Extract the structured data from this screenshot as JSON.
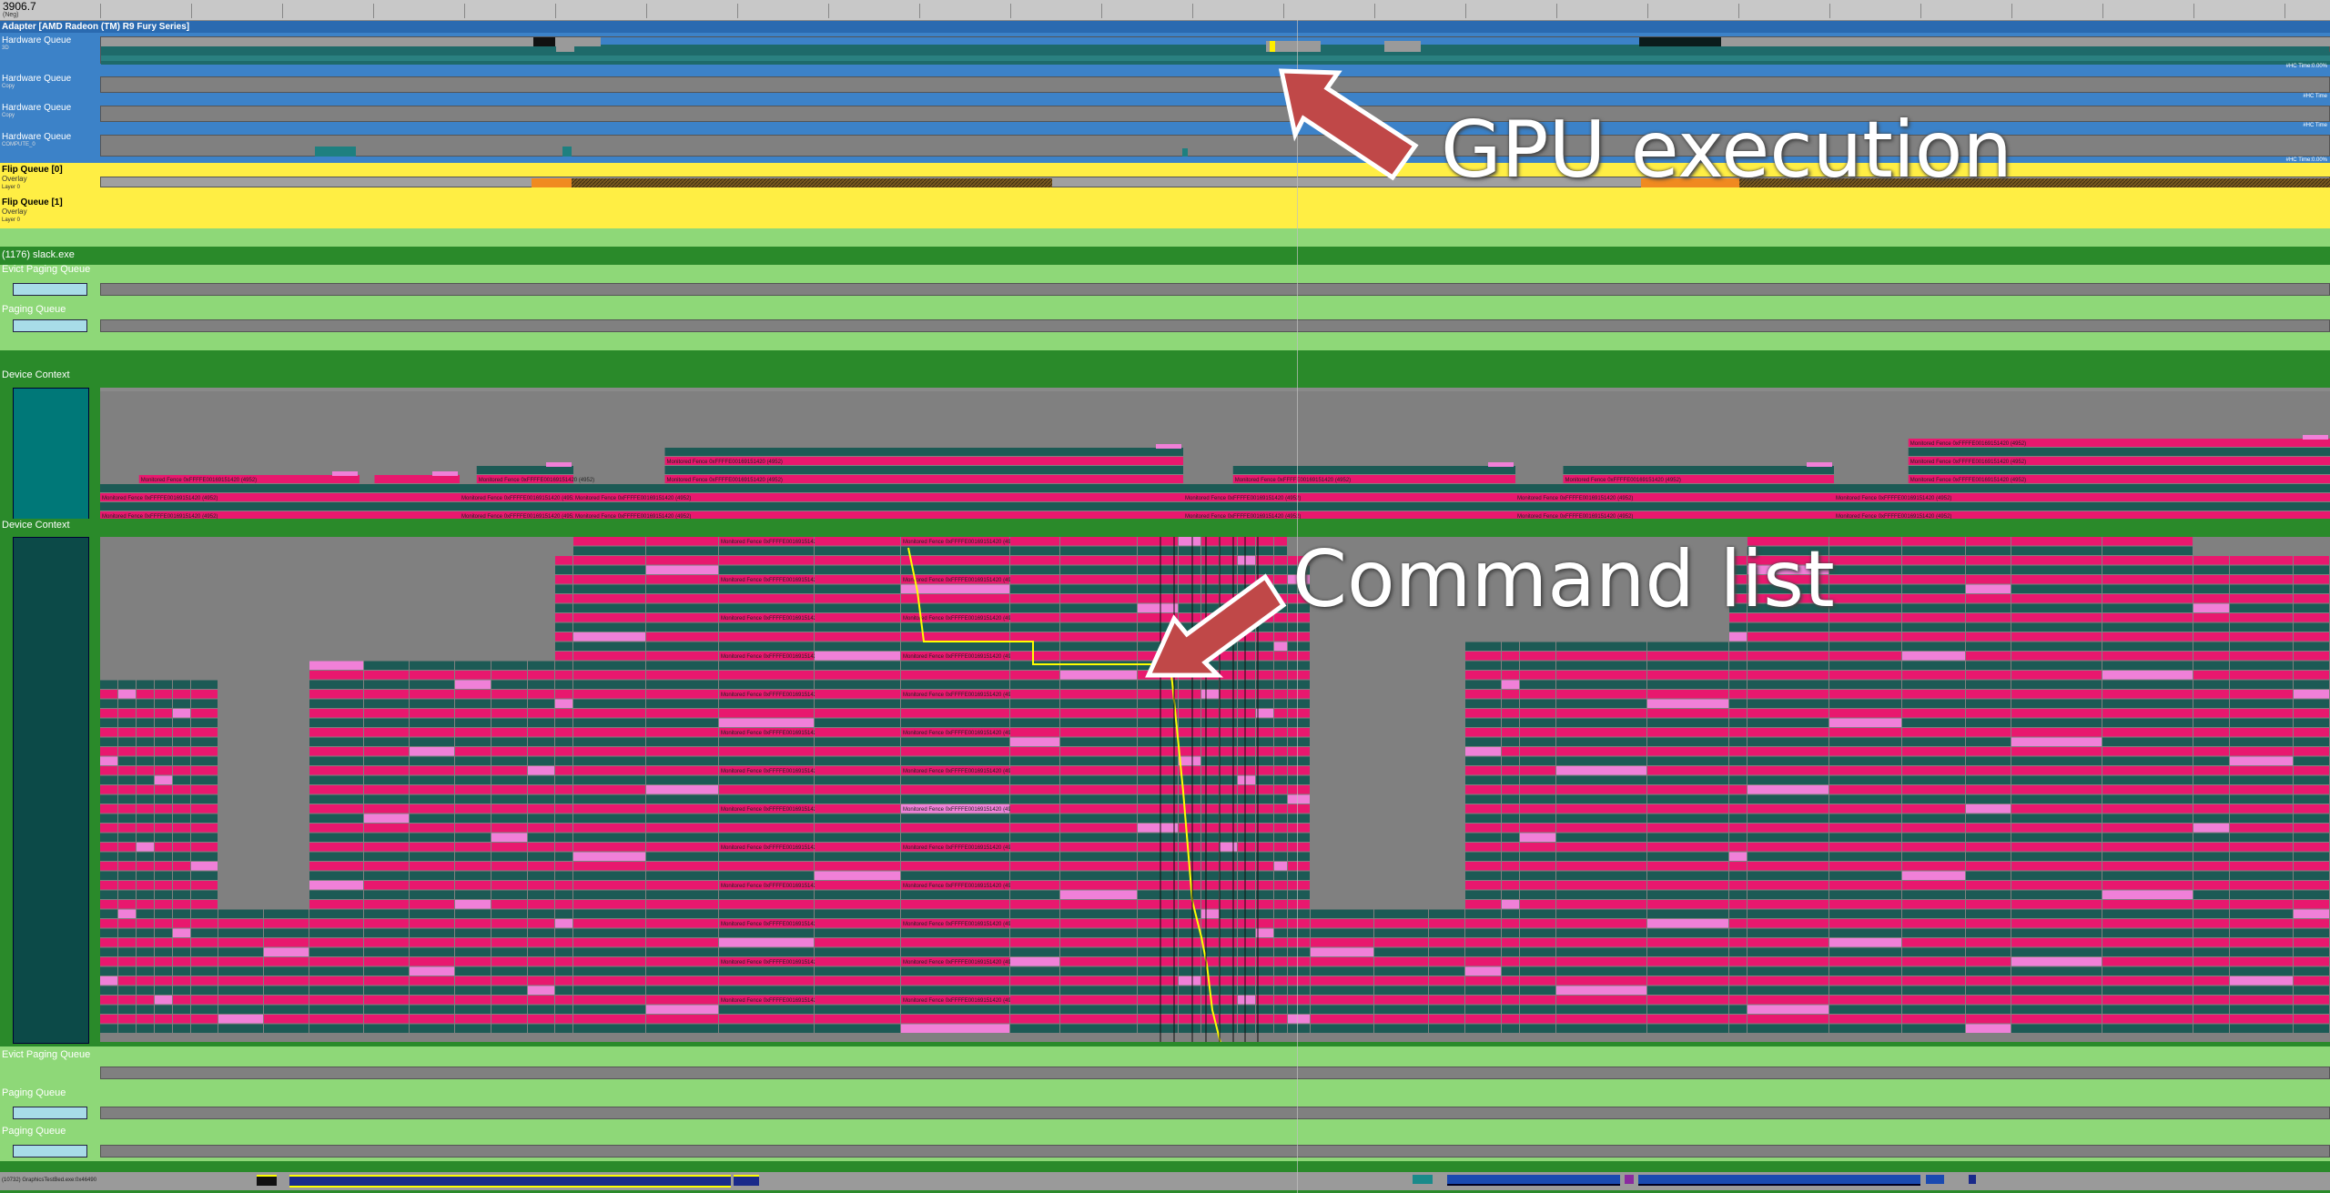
{
  "ruler": {
    "value": "3906.7",
    "sub": "(Neg)"
  },
  "adapter": {
    "title": "Adapter [AMD Radeon (TM) R9 Fury Series]"
  },
  "hw_queues": [
    {
      "label": "Hardware Queue",
      "sub": "3D",
      "rtag": "#HC Time:0.00%"
    },
    {
      "label": "Hardware Queue",
      "sub": "Copy",
      "rtag": "#HC Time"
    },
    {
      "label": "Hardware Queue",
      "sub": "Copy",
      "rtag": "#HC Time"
    },
    {
      "label": "Hardware Queue",
      "sub": "COMPUTE_0",
      "rtag": "#HC Time:0.00%"
    }
  ],
  "flip_queues": [
    {
      "label": "Flip Queue [0]",
      "sub1": "Overlay",
      "sub2": "Layer 0"
    },
    {
      "label": "Flip Queue [1]",
      "sub1": "Overlay",
      "sub2": "Layer 0"
    }
  ],
  "process": {
    "title": "(1176) slack.exe",
    "evict": "Evict Paging Queue",
    "paging": "Paging Queue",
    "device_context_1": "Device Context",
    "device_context_2": "Device Context"
  },
  "bottom_queues": [
    {
      "label": "Evict Paging Queue"
    },
    {
      "label": "Paging Queue"
    },
    {
      "label": "Paging Queue"
    }
  ],
  "bottom_process": {
    "label": "(10732) GraphicsTestBed.exe:0x46490"
  },
  "fence_label": "Monitored Fence 0xFFFFE00169151420 (4952)",
  "callouts": {
    "gpu": "GPU execution",
    "cmd": "Command list"
  },
  "colors": {
    "hw_blue": "#3c82c8",
    "gpu_teal": "#1e6a6a",
    "flip_yellow": "#ffee44",
    "green_light": "#8ed878",
    "green_dark": "#2a8a2a",
    "fence_pink": "#e8186e",
    "fence_teal": "#1c5a55",
    "fence_light": "#f080d8",
    "arrow_red": "#c04848"
  }
}
